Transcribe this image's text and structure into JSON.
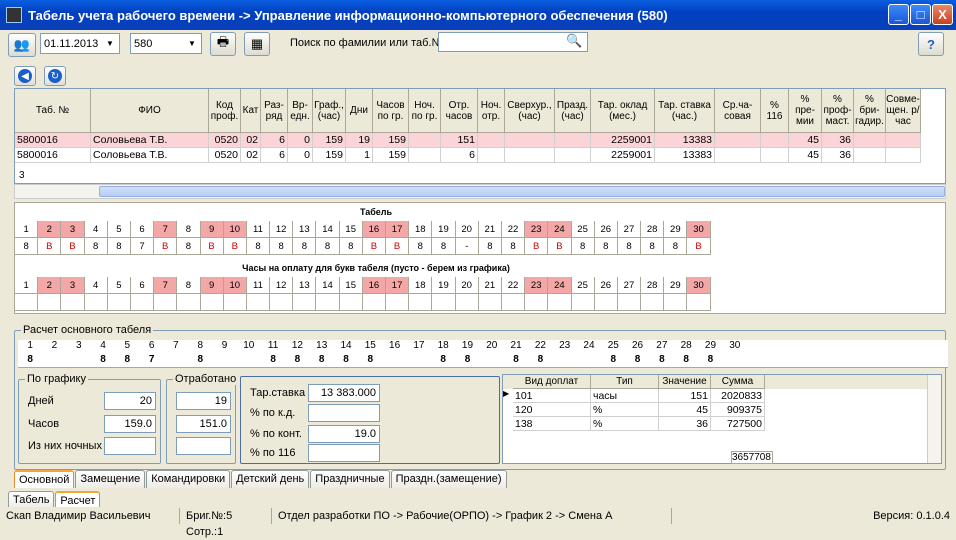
{
  "window": {
    "title": "Табель учета рабочего времени -> Управление информационно-компьютерного обеспечения (580)",
    "min": "_",
    "max": "□",
    "close": "X"
  },
  "toolbar": {
    "date": "01.11.2013",
    "dept": "580",
    "search_label": "Поиск по фамилии или таб.№",
    "search_value": ""
  },
  "grid": {
    "headers": [
      "Таб. №",
      "ФИО",
      "Код проф.",
      "Кат",
      "Раз- ряд",
      "Вр- едн.",
      "Граф., (час)",
      "Дни",
      "Часов по гр.",
      "Ноч. по гр.",
      "Отр. часов",
      "Ноч. отр.",
      "Сверхур., (час)",
      "Празд. (час)",
      "Тар. оклад (мес.)",
      "Тар. ставка (час.)",
      "Ср.ча- совая",
      "% 116",
      "% пре- мии",
      "% проф- маст.",
      "% бри- гадир.",
      "Совме- щен. р/час"
    ],
    "rows": [
      [
        "5800016",
        "Соловьева Т.В.",
        "0520",
        "02",
        "6",
        "0",
        "159",
        "19",
        "159",
        "",
        "151",
        "",
        "",
        "",
        "2259001",
        "13383",
        "",
        "",
        "45",
        "36",
        "",
        ""
      ],
      [
        "5800016",
        "Соловьева Т.В.",
        "0520",
        "02",
        "6",
        "0",
        "159",
        "1",
        "159",
        "",
        "6",
        "",
        "",
        "",
        "2259001",
        "13383",
        "",
        "",
        "45",
        "36",
        "",
        ""
      ]
    ],
    "footer_count": "3"
  },
  "tabel": {
    "title": "Табель",
    "days": [
      "1",
      "2",
      "3",
      "4",
      "5",
      "6",
      "7",
      "8",
      "9",
      "10",
      "11",
      "12",
      "13",
      "14",
      "15",
      "16",
      "17",
      "18",
      "19",
      "20",
      "21",
      "22",
      "23",
      "24",
      "25",
      "26",
      "27",
      "28",
      "29",
      "30"
    ],
    "weekend_days": [
      2,
      3,
      7,
      9,
      10,
      16,
      17,
      23,
      24,
      30
    ],
    "values": [
      "8",
      "В",
      "В",
      "8",
      "8",
      "7",
      "В",
      "8",
      "В",
      "В",
      "8",
      "8",
      "8",
      "8",
      "8",
      "В",
      "В",
      "8",
      "8",
      "-",
      "8",
      "8",
      "В",
      "В",
      "8",
      "8",
      "8",
      "8",
      "8",
      "В"
    ],
    "pay_title": "Часы на оплату для букв табеля (пусто - берем из графика)"
  },
  "calc": {
    "title": "Расчет основного табеля",
    "days": [
      "1",
      "2",
      "3",
      "4",
      "5",
      "6",
      "7",
      "8",
      "9",
      "10",
      "11",
      "12",
      "13",
      "14",
      "15",
      "16",
      "17",
      "18",
      "19",
      "20",
      "21",
      "22",
      "23",
      "24",
      "25",
      "26",
      "27",
      "28",
      "29",
      "30"
    ],
    "values": [
      "8",
      "",
      "",
      "8",
      "8",
      "7",
      "",
      "8",
      "",
      "",
      "8",
      "8",
      "8",
      "8",
      "8",
      "",
      "",
      "8",
      "8",
      "",
      "8",
      "8",
      "",
      "",
      "8",
      "8",
      "8",
      "8",
      "8",
      ""
    ],
    "schedule": {
      "legend": "По графику",
      "days_label": "Дней",
      "days": "20",
      "hours_label": "Часов",
      "hours": "159.0",
      "night_label": "Из них ночных",
      "night": ""
    },
    "worked": {
      "legend": "Отработано",
      "days": "19",
      "hours": "151.0",
      "night": ""
    },
    "rates": {
      "rate_label": "Тар.ставка",
      "rate": "13 383.000",
      "kd_label": "% по к.д.",
      "kd": "",
      "cont_label": "% по конт.",
      "cont": "19.0",
      "p116_label": "% по 116",
      "p116": ""
    },
    "payments": {
      "headers": [
        "Вид доплат",
        "Тип",
        "Значение",
        "Сумма"
      ],
      "rows": [
        [
          "101",
          "часы",
          "151",
          "2020833"
        ],
        [
          "120",
          "%",
          "45",
          "909375"
        ],
        [
          "138",
          "%",
          "36",
          "727500"
        ]
      ],
      "total": "3657708"
    }
  },
  "subtabs": [
    "Основной",
    "Замещение",
    "Командировки",
    "Детский день",
    "Праздничные",
    "Праздн.(замещение)"
  ],
  "maintabs": [
    "Табель",
    "Расчет"
  ],
  "status": [
    "Скап Владимир Васильевич",
    "Бриг.№:5 Сотр.:1",
    "Отдел разработки ПО -> Рабочие(ОРПО) -> График 2 -> Смена А",
    "Версия: 0.1.0.4"
  ]
}
